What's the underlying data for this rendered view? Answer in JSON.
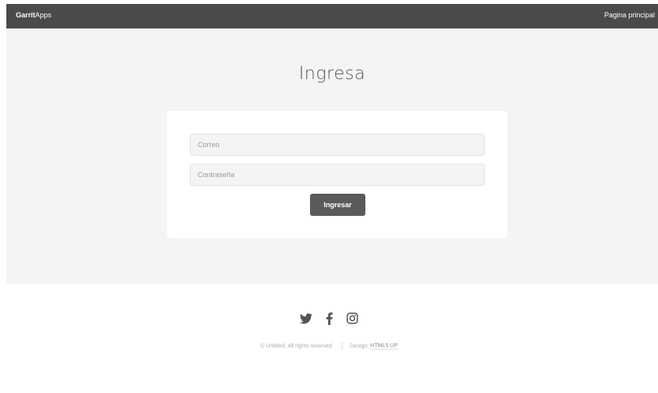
{
  "header": {
    "brand_bold": "Garrit",
    "brand_rest": "Apps",
    "nav_home": "Pagina principal"
  },
  "main": {
    "title": "Ingresa",
    "form": {
      "email_placeholder": "Correo",
      "password_placeholder": "Contraseña",
      "submit_label": "Ingresar"
    }
  },
  "footer": {
    "icons": [
      "twitter-icon",
      "facebook-icon",
      "instagram-icon"
    ],
    "copyright": "© Untitled. All rights reserved.",
    "design_label": "Design:",
    "design_link": "HTML5 UP"
  },
  "colors": {
    "topbar": "#4a4a4a",
    "banner": "#f4f4f4",
    "button": "#5a5a5a"
  }
}
